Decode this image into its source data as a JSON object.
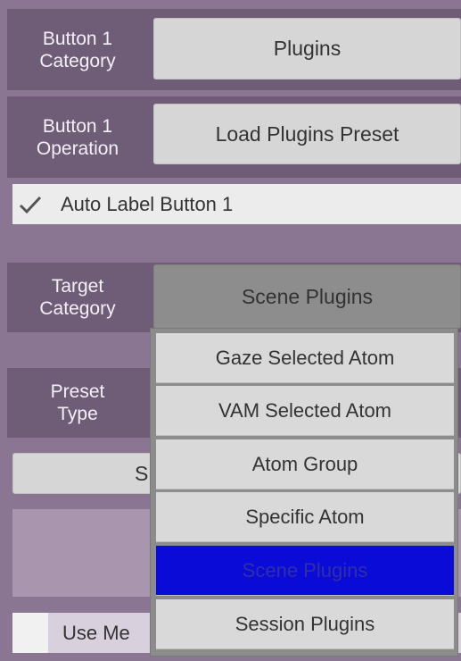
{
  "button1_category": {
    "label_line1": "Button 1",
    "label_line2": "Category",
    "value": "Plugins"
  },
  "button1_operation": {
    "label_line1": "Button 1",
    "label_line2": "Operation",
    "value": "Load Plugins Preset"
  },
  "auto_label": {
    "checked": true,
    "text": "Auto Label Button 1"
  },
  "target_category": {
    "label_line1": "Target",
    "label_line2": "Category",
    "value": "Scene Plugins"
  },
  "preset_type": {
    "label_line1": "Preset",
    "label_line2": "Type"
  },
  "partial_button": {
    "text": "S"
  },
  "use_toggle": {
    "checked": false,
    "text": "Use Me"
  },
  "dropdown": {
    "options": [
      "Gaze Selected Atom",
      "VAM Selected Atom",
      "Atom Group",
      "Specific Atom",
      "Scene Plugins",
      "Session Plugins"
    ],
    "selected_index": 4
  },
  "colors": {
    "selected_option": "#0b0bd8",
    "panel_bg": "#8a7593",
    "label_bg": "#6f5d78"
  }
}
